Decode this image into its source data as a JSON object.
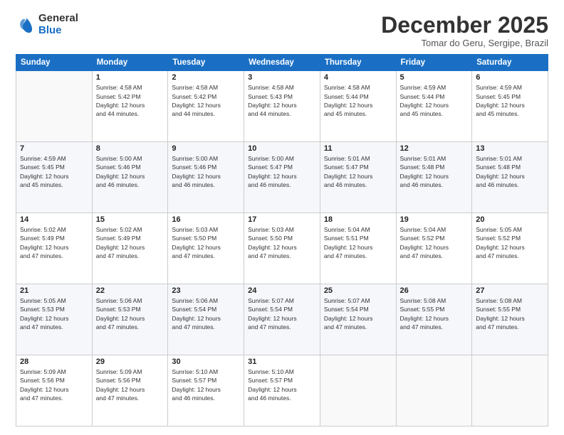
{
  "logo": {
    "general": "General",
    "blue": "Blue"
  },
  "header": {
    "month": "December 2025",
    "location": "Tomar do Geru, Sergipe, Brazil"
  },
  "weekdays": [
    "Sunday",
    "Monday",
    "Tuesday",
    "Wednesday",
    "Thursday",
    "Friday",
    "Saturday"
  ],
  "weeks": [
    [
      {
        "day": "",
        "info": ""
      },
      {
        "day": "1",
        "info": "Sunrise: 4:58 AM\nSunset: 5:42 PM\nDaylight: 12 hours\nand 44 minutes."
      },
      {
        "day": "2",
        "info": "Sunrise: 4:58 AM\nSunset: 5:42 PM\nDaylight: 12 hours\nand 44 minutes."
      },
      {
        "day": "3",
        "info": "Sunrise: 4:58 AM\nSunset: 5:43 PM\nDaylight: 12 hours\nand 44 minutes."
      },
      {
        "day": "4",
        "info": "Sunrise: 4:58 AM\nSunset: 5:44 PM\nDaylight: 12 hours\nand 45 minutes."
      },
      {
        "day": "5",
        "info": "Sunrise: 4:59 AM\nSunset: 5:44 PM\nDaylight: 12 hours\nand 45 minutes."
      },
      {
        "day": "6",
        "info": "Sunrise: 4:59 AM\nSunset: 5:45 PM\nDaylight: 12 hours\nand 45 minutes."
      }
    ],
    [
      {
        "day": "7",
        "info": "Sunrise: 4:59 AM\nSunset: 5:45 PM\nDaylight: 12 hours\nand 45 minutes."
      },
      {
        "day": "8",
        "info": "Sunrise: 5:00 AM\nSunset: 5:46 PM\nDaylight: 12 hours\nand 46 minutes."
      },
      {
        "day": "9",
        "info": "Sunrise: 5:00 AM\nSunset: 5:46 PM\nDaylight: 12 hours\nand 46 minutes."
      },
      {
        "day": "10",
        "info": "Sunrise: 5:00 AM\nSunset: 5:47 PM\nDaylight: 12 hours\nand 46 minutes."
      },
      {
        "day": "11",
        "info": "Sunrise: 5:01 AM\nSunset: 5:47 PM\nDaylight: 12 hours\nand 46 minutes."
      },
      {
        "day": "12",
        "info": "Sunrise: 5:01 AM\nSunset: 5:48 PM\nDaylight: 12 hours\nand 46 minutes."
      },
      {
        "day": "13",
        "info": "Sunrise: 5:01 AM\nSunset: 5:48 PM\nDaylight: 12 hours\nand 46 minutes."
      }
    ],
    [
      {
        "day": "14",
        "info": "Sunrise: 5:02 AM\nSunset: 5:49 PM\nDaylight: 12 hours\nand 47 minutes."
      },
      {
        "day": "15",
        "info": "Sunrise: 5:02 AM\nSunset: 5:49 PM\nDaylight: 12 hours\nand 47 minutes."
      },
      {
        "day": "16",
        "info": "Sunrise: 5:03 AM\nSunset: 5:50 PM\nDaylight: 12 hours\nand 47 minutes."
      },
      {
        "day": "17",
        "info": "Sunrise: 5:03 AM\nSunset: 5:50 PM\nDaylight: 12 hours\nand 47 minutes."
      },
      {
        "day": "18",
        "info": "Sunrise: 5:04 AM\nSunset: 5:51 PM\nDaylight: 12 hours\nand 47 minutes."
      },
      {
        "day": "19",
        "info": "Sunrise: 5:04 AM\nSunset: 5:52 PM\nDaylight: 12 hours\nand 47 minutes."
      },
      {
        "day": "20",
        "info": "Sunrise: 5:05 AM\nSunset: 5:52 PM\nDaylight: 12 hours\nand 47 minutes."
      }
    ],
    [
      {
        "day": "21",
        "info": "Sunrise: 5:05 AM\nSunset: 5:53 PM\nDaylight: 12 hours\nand 47 minutes."
      },
      {
        "day": "22",
        "info": "Sunrise: 5:06 AM\nSunset: 5:53 PM\nDaylight: 12 hours\nand 47 minutes."
      },
      {
        "day": "23",
        "info": "Sunrise: 5:06 AM\nSunset: 5:54 PM\nDaylight: 12 hours\nand 47 minutes."
      },
      {
        "day": "24",
        "info": "Sunrise: 5:07 AM\nSunset: 5:54 PM\nDaylight: 12 hours\nand 47 minutes."
      },
      {
        "day": "25",
        "info": "Sunrise: 5:07 AM\nSunset: 5:54 PM\nDaylight: 12 hours\nand 47 minutes."
      },
      {
        "day": "26",
        "info": "Sunrise: 5:08 AM\nSunset: 5:55 PM\nDaylight: 12 hours\nand 47 minutes."
      },
      {
        "day": "27",
        "info": "Sunrise: 5:08 AM\nSunset: 5:55 PM\nDaylight: 12 hours\nand 47 minutes."
      }
    ],
    [
      {
        "day": "28",
        "info": "Sunrise: 5:09 AM\nSunset: 5:56 PM\nDaylight: 12 hours\nand 47 minutes."
      },
      {
        "day": "29",
        "info": "Sunrise: 5:09 AM\nSunset: 5:56 PM\nDaylight: 12 hours\nand 47 minutes."
      },
      {
        "day": "30",
        "info": "Sunrise: 5:10 AM\nSunset: 5:57 PM\nDaylight: 12 hours\nand 46 minutes."
      },
      {
        "day": "31",
        "info": "Sunrise: 5:10 AM\nSunset: 5:57 PM\nDaylight: 12 hours\nand 46 minutes."
      },
      {
        "day": "",
        "info": ""
      },
      {
        "day": "",
        "info": ""
      },
      {
        "day": "",
        "info": ""
      }
    ]
  ]
}
